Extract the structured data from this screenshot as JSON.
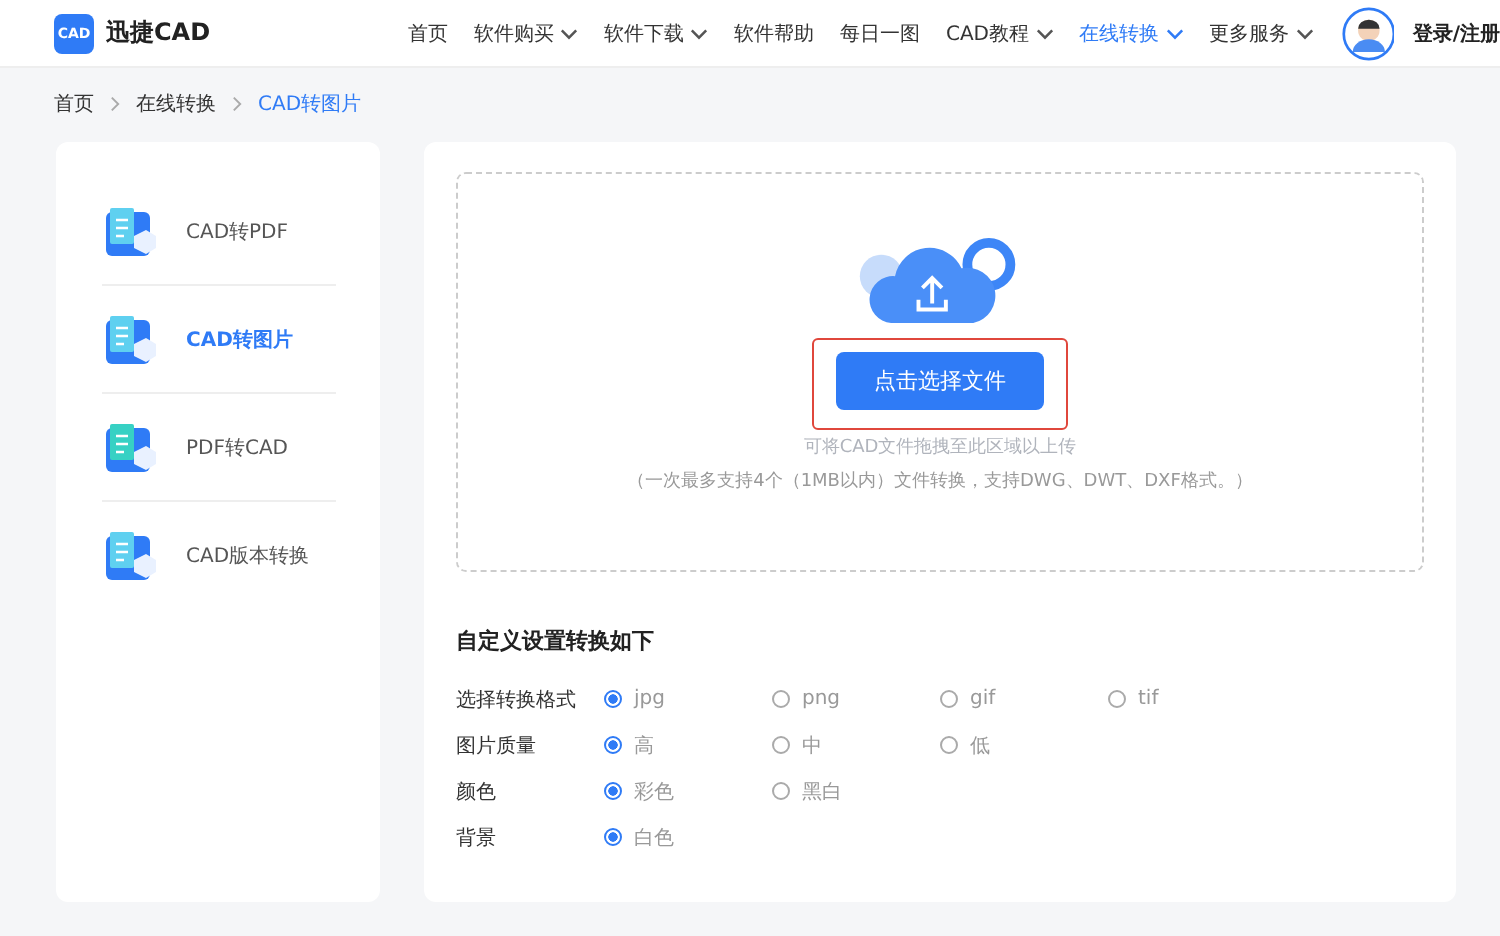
{
  "header": {
    "logo_badge": "CAD",
    "brand": "迅捷CAD",
    "nav": [
      {
        "label": "首页",
        "dropdown": false,
        "selected": false
      },
      {
        "label": "软件购买",
        "dropdown": true,
        "selected": false
      },
      {
        "label": "软件下载",
        "dropdown": true,
        "selected": false
      },
      {
        "label": "软件帮助",
        "dropdown": false,
        "selected": false
      },
      {
        "label": "每日一图",
        "dropdown": false,
        "selected": false
      },
      {
        "label": "CAD教程",
        "dropdown": true,
        "selected": false
      },
      {
        "label": "在线转换",
        "dropdown": true,
        "selected": true
      },
      {
        "label": "更多服务",
        "dropdown": true,
        "selected": false
      }
    ],
    "login": "登录/注册"
  },
  "breadcrumb": [
    {
      "label": "首页",
      "current": false
    },
    {
      "label": "在线转换",
      "current": false
    },
    {
      "label": "CAD转图片",
      "current": true
    }
  ],
  "sidebar": {
    "items": [
      {
        "label": "CAD转PDF",
        "selected": false
      },
      {
        "label": "CAD转图片",
        "selected": true
      },
      {
        "label": "PDF转CAD",
        "selected": false
      },
      {
        "label": "CAD版本转换",
        "selected": false
      }
    ]
  },
  "upload": {
    "button": "点击选择文件",
    "hint": "可将CAD文件拖拽至此区域以上传",
    "note": "（一次最多支持4个（1MB以内）文件转换，支持DWG、DWT、DXF格式。）",
    "highlighted": true
  },
  "settings": {
    "title": "自定义设置转换如下",
    "rows": [
      {
        "label": "选择转换格式",
        "options": [
          {
            "label": "jpg",
            "selected": true
          },
          {
            "label": "png",
            "selected": false
          },
          {
            "label": "gif",
            "selected": false
          },
          {
            "label": "tif",
            "selected": false
          }
        ]
      },
      {
        "label": "图片质量",
        "options": [
          {
            "label": "高",
            "selected": true
          },
          {
            "label": "中",
            "selected": false
          },
          {
            "label": "低",
            "selected": false
          }
        ]
      },
      {
        "label": "颜色",
        "options": [
          {
            "label": "彩色",
            "selected": true
          },
          {
            "label": "黑白",
            "selected": false
          }
        ]
      },
      {
        "label": "背景",
        "options": [
          {
            "label": "白色",
            "selected": true
          }
        ]
      }
    ]
  }
}
